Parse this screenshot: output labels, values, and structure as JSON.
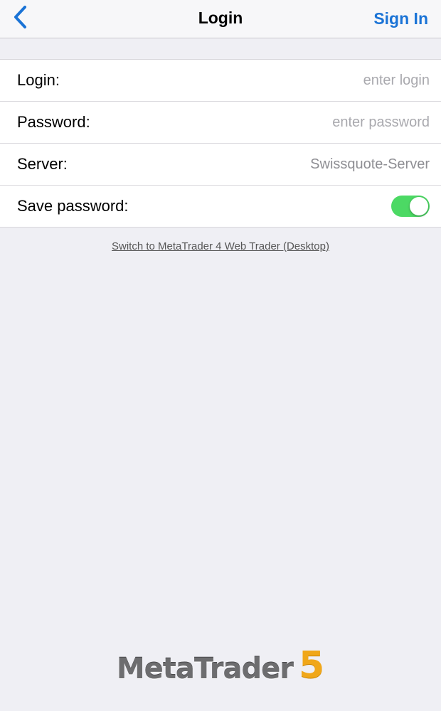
{
  "navbar": {
    "title": "Login",
    "back_icon": "chevron-left-icon",
    "signin_label": "Sign In",
    "accent_color": "#1a73d6"
  },
  "form": {
    "login": {
      "label": "Login:",
      "value": "",
      "placeholder": "enter login"
    },
    "password": {
      "label": "Password:",
      "value": "",
      "placeholder": "enter password"
    },
    "server": {
      "label": "Server:",
      "value": "Swissquote-Server"
    },
    "save_password": {
      "label": "Save password:",
      "enabled": true,
      "toggle_color": "#4cd964"
    }
  },
  "switch_link": "Switch to MetaTrader 4 Web Trader (Desktop)",
  "logo": {
    "text": "MetaTrader",
    "number": "5",
    "number_color": "#f0a71a"
  }
}
